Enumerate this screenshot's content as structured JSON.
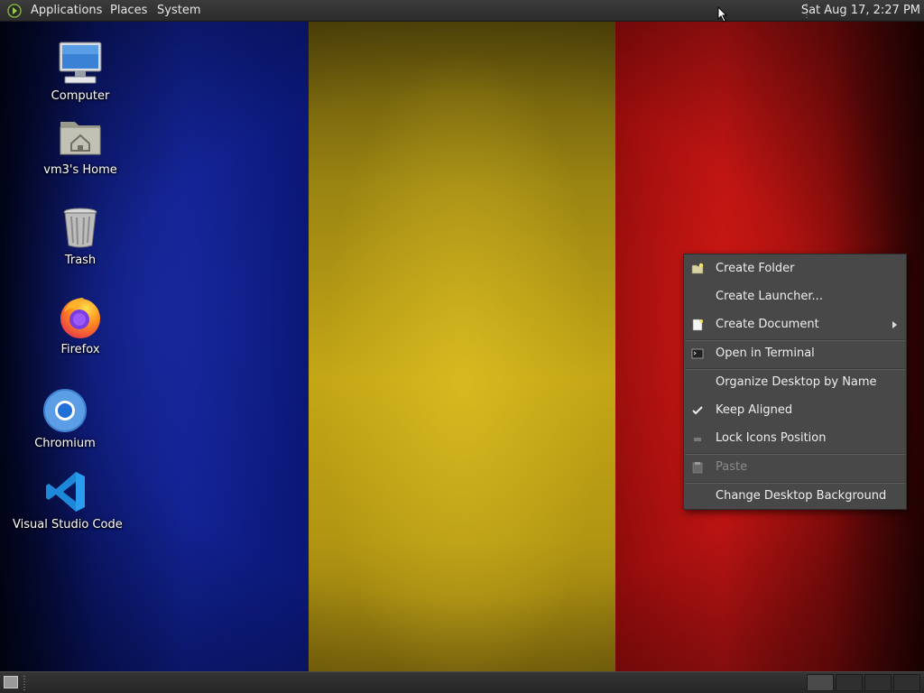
{
  "top_panel": {
    "menus": [
      "Applications",
      "Places",
      "System"
    ],
    "clock": "Sat Aug 17,  2:27 PM"
  },
  "desktop_icons": [
    {
      "label": "Computer",
      "icon": "computer-icon"
    },
    {
      "label": "vm3's Home",
      "icon": "home-folder-icon"
    },
    {
      "label": "Trash",
      "icon": "trash-icon"
    },
    {
      "label": "Firefox",
      "icon": "firefox-icon"
    },
    {
      "label": "Chromium",
      "icon": "chromium-icon"
    },
    {
      "label": "Visual Studio Code",
      "icon": "vscode-icon"
    }
  ],
  "context_menu": {
    "items": [
      {
        "label": "Create Folder",
        "icon": "new-folder-icon"
      },
      {
        "label": "Create Launcher..."
      },
      {
        "label": "Create Document",
        "icon": "new-document-icon",
        "submenu": true
      },
      {
        "label": "Open in Terminal",
        "icon": "terminal-icon"
      },
      {
        "label": "Organize Desktop by Name"
      },
      {
        "label": "Keep Aligned",
        "checked": true,
        "icon": "checkmark-icon"
      },
      {
        "label": "Lock Icons Position",
        "icon": "lock-icon"
      },
      {
        "label": "Paste",
        "icon": "paste-icon",
        "disabled": true
      },
      {
        "label": "Change Desktop Background"
      }
    ]
  },
  "workspaces": {
    "count": 4,
    "active": 1
  },
  "colors": {
    "flag_blue": "#0f1f8e",
    "flag_yellow": "#c4a616",
    "flag_red": "#b31212",
    "panel": "#2b2b2b",
    "menu_bg": "#484848"
  }
}
